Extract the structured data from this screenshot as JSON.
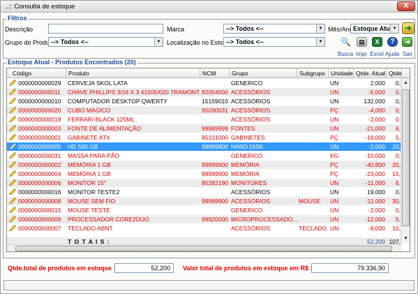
{
  "window": {
    "title": "..:: Consulta de estoque",
    "close_label": "X"
  },
  "filtros": {
    "legend": "Filtros",
    "descricao_label": "Descrição",
    "descricao_value": "",
    "marca_label": "Marca",
    "marca_value": "--> Todos <--",
    "mes_ano_label": "Mês/Ano",
    "mes_ano_value": "Estoque Atual",
    "grupo_label": "Grupo do Produto",
    "grupo_value": "--> Todos <--",
    "localizacao_label": "Localização no Estoque",
    "localizacao_value": "--> Todos <--"
  },
  "toolbar": {
    "busca": "Busca",
    "impr": "Impr",
    "excel": "Excel",
    "ajuda": "Ajuda",
    "sair": "Sair"
  },
  "results": {
    "legend": "Estoque Atual - Produtos Encontrados (20)",
    "columns": [
      "Código",
      "Produto",
      "NCM",
      "Grupo",
      "Subgrupo",
      "Unidade",
      "Qtde. Atual",
      "Qtde.Mín"
    ],
    "rows": [
      {
        "codigo": "0000000000029",
        "produto": "CERVEJA SKOL LATA",
        "ncm": "",
        "grupo": "GENERICO",
        "subgrupo": "",
        "unidade": "UN",
        "qtde": "2,000",
        "min": "0,",
        "color": "black"
      },
      {
        "codigo": "0000000000011",
        "produto": "CHAVE PHILLIPS 3/16 X 3 41505/020 TRAMONT...",
        "ncm": "82054000",
        "grupo": "ACESSÓRIOS",
        "subgrupo": "",
        "unidade": "UN",
        "qtde": "-5,000",
        "min": "0,",
        "color": "red"
      },
      {
        "codigo": "0000000000010",
        "produto": "COMPUTADOR DESKTOP QWERTY",
        "ncm": "15159010",
        "grupo": "ACESSÓRIOS",
        "subgrupo": "",
        "unidade": "UN",
        "qtde": "132,000",
        "min": "0,",
        "color": "black"
      },
      {
        "codigo": "0000000000020",
        "produto": "CUBO MAGICO",
        "ncm": "95030031",
        "grupo": "ACESSÓRIOS",
        "subgrupo": "",
        "unidade": "PÇ",
        "qtde": "-4,000",
        "min": "0,",
        "color": "red"
      },
      {
        "codigo": "0000000000019",
        "produto": "FERRARI BLACK 125ML",
        "ncm": "",
        "grupo": "ACESSÓRIOS",
        "subgrupo": "",
        "unidade": "UN",
        "qtde": "-2,000",
        "min": "0,",
        "color": "red"
      },
      {
        "codigo": "0000000000003",
        "produto": "FONTE DE ALIMENTAÇÃO",
        "ncm": "99999999",
        "grupo": "FONTES",
        "subgrupo": "",
        "unidade": "UN",
        "qtde": "-21,000",
        "min": "6,",
        "color": "red"
      },
      {
        "codigo": "0000000000001",
        "produto": "GABINETE ATX",
        "ncm": "85101000",
        "grupo": "GABINETES",
        "subgrupo": "",
        "unidade": "PÇ",
        "qtde": "-18,000",
        "min": "5,",
        "color": "red"
      },
      {
        "codigo": "0000000000005",
        "produto": "HD 500 GB",
        "ncm": "99999900",
        "grupo": "HARD DISK",
        "subgrupo": "",
        "unidade": "UN",
        "qtde": "-2,000",
        "min": "10,",
        "color": "sel"
      },
      {
        "codigo": "0000000000031",
        "produto": "MASSA PARA PÃO",
        "ncm": "",
        "grupo": "GENERICO",
        "subgrupo": "",
        "unidade": "KG",
        "qtde": "-10,000",
        "min": "0,",
        "color": "red"
      },
      {
        "codigo": "0000000000002",
        "produto": "MEMÓRIA 1 GB",
        "ncm": "99999900",
        "grupo": "MEMÓRIA",
        "subgrupo": "",
        "unidade": "PÇ",
        "qtde": "-40,800",
        "min": "20,",
        "color": "red"
      },
      {
        "codigo": "0000000000004",
        "produto": "MEMÓRIA 1 GB",
        "ncm": "99999900",
        "grupo": "MEMÓRIA",
        "subgrupo": "",
        "unidade": "PÇ",
        "qtde": "-23,000",
        "min": "15,",
        "color": "red"
      },
      {
        "codigo": "0000000000006",
        "produto": "MONITOR 15\"",
        "ncm": "85282190",
        "grupo": "MONITORES",
        "subgrupo": "",
        "unidade": "UN",
        "qtde": "-11,000",
        "min": "6,",
        "color": "red"
      },
      {
        "codigo": "0000000000016",
        "produto": "MONITOR TESTE2",
        "ncm": "",
        "grupo": "ACESSÓRIOS",
        "subgrupo": "",
        "unidade": "UN",
        "qtde": "19,000",
        "min": "0,",
        "color": "black"
      },
      {
        "codigo": "0000000000008",
        "produto": "MOUSE SEM FIO",
        "ncm": "99999900",
        "grupo": "ACESSÓRIOS",
        "subgrupo": "MOUSE",
        "unidade": "UN",
        "qtde": "-11,000",
        "min": "30,",
        "color": "red"
      },
      {
        "codigo": "0000000000015",
        "produto": "MOUSE TESTE",
        "ncm": "",
        "grupo": "GENERICO",
        "subgrupo": "",
        "unidade": "UN",
        "qtde": "-2,000",
        "min": "0,",
        "color": "red"
      },
      {
        "codigo": "0000000000009",
        "produto": "PROCESSADOR CORE2DUO",
        "ncm": "99920000",
        "grupo": "MICROPROCESSADO...",
        "subgrupo": "",
        "unidade": "UN",
        "qtde": "-12,000",
        "min": "5,",
        "color": "red"
      },
      {
        "codigo": "0000000000007",
        "produto": "TECLADO ABNT",
        "ncm": "",
        "grupo": "ACESSÓRIOS",
        "subgrupo": "TECLADO",
        "unidade": "UN",
        "qtde": "-9,000",
        "min": "10,",
        "color": "red"
      }
    ],
    "totals_label": "T O T A I S :",
    "totals_qtde": "52,200",
    "totals_min": "107,"
  },
  "summary": {
    "qtde_total_label": "Qtde.total de produtos em estoque :",
    "qtde_total_value": "52,200",
    "valor_total_label": "Valor total de produtos em estoque em R$ :",
    "valor_total_value": "79.336,90"
  },
  "colors": {
    "accent_blue": "#1f4e9b",
    "negative_red": "#e00000",
    "selection": "#3399ff"
  },
  "icons": [
    "close-icon",
    "chevron-down-icon",
    "arrow-right-icon",
    "search-icon",
    "printer-icon",
    "excel-icon",
    "help-icon",
    "exit-icon",
    "pencil-icon",
    "scroll-up-icon",
    "scroll-down-icon"
  ]
}
